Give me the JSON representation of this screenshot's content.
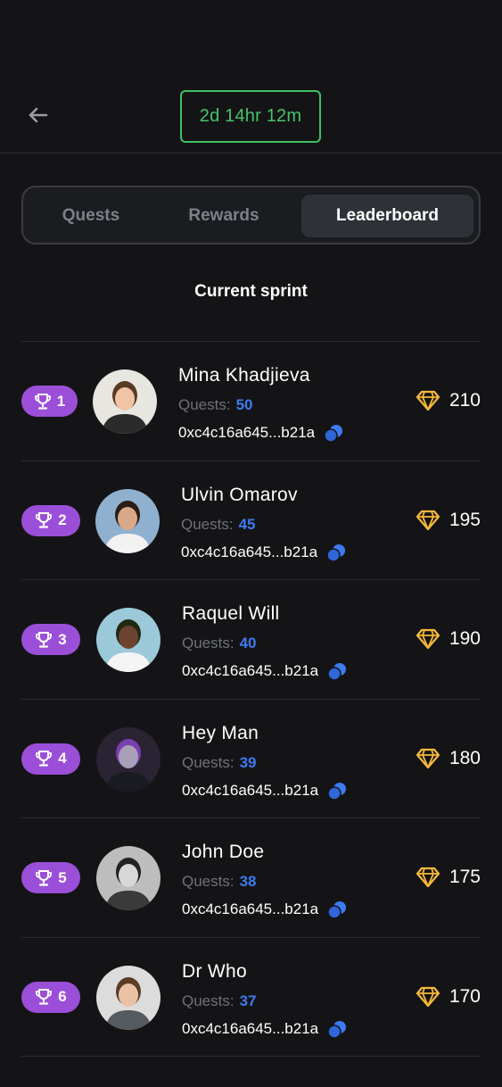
{
  "header": {
    "back_icon": "arrow-left-icon",
    "timer": "2d 14hr 12m",
    "timer_color": "#46c46a"
  },
  "tabs": [
    {
      "label": "Quests",
      "active": false
    },
    {
      "label": "Rewards",
      "active": false
    },
    {
      "label": "Leaderboard",
      "active": true
    }
  ],
  "section_title": "Current sprint",
  "colors": {
    "badge": "#9b4fd9",
    "quest_value": "#3d7bf2",
    "diamond": "#f5b93a"
  },
  "leaderboard": [
    {
      "rank": "1",
      "name": "Mina Khadjieva",
      "quests_label": "Quests:",
      "quests": "50",
      "wallet": "0xc4c16a645...b21a",
      "score": "210"
    },
    {
      "rank": "2",
      "name": "Ulvin Omarov",
      "quests_label": "Quests:",
      "quests": "45",
      "wallet": "0xc4c16a645...b21a",
      "score": "195"
    },
    {
      "rank": "3",
      "name": "Raquel Will",
      "quests_label": "Quests:",
      "quests": "40",
      "wallet": "0xc4c16a645...b21a",
      "score": "190"
    },
    {
      "rank": "4",
      "name": "Hey Man",
      "quests_label": "Quests:",
      "quests": "39",
      "wallet": "0xc4c16a645...b21a",
      "score": "180"
    },
    {
      "rank": "5",
      "name": "John Doe",
      "quests_label": "Quests:",
      "quests": "38",
      "wallet": "0xc4c16a645...b21a",
      "score": "175"
    },
    {
      "rank": "6",
      "name": "Dr Who",
      "quests_label": "Quests:",
      "quests": "37",
      "wallet": "0xc4c16a645...b21a",
      "score": "170"
    }
  ]
}
